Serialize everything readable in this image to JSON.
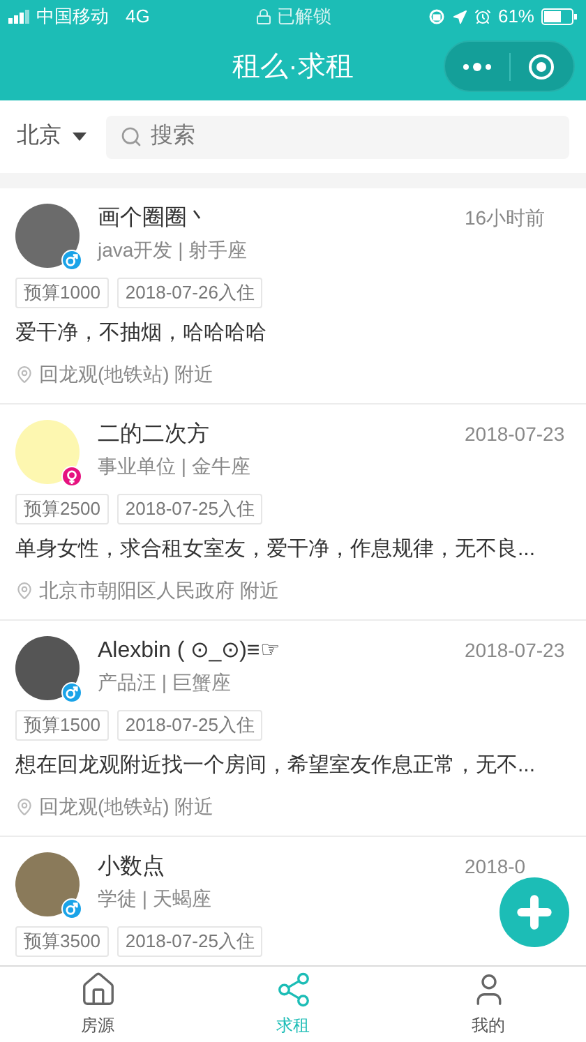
{
  "status_bar": {
    "carrier": "中国移动",
    "network": "4G",
    "lock_text": "已解锁",
    "battery": "61%"
  },
  "header": {
    "title": "租么·求租"
  },
  "search_bar": {
    "city": "北京",
    "placeholder": "搜索"
  },
  "posts": [
    {
      "name": "画个圈圈丶",
      "kind": "male",
      "avatar": {
        "color": "#6b6b6b"
      },
      "meta": "java开发 | 射手座",
      "time": "16小时前",
      "budget": "预算1000",
      "move_in": "2018-07-26入住",
      "description": "爱干净，不抽烟，哈哈哈哈",
      "location": "回龙观(地铁站) 附近"
    },
    {
      "name": "二的二次方",
      "kind": "female",
      "avatar": {
        "color": "#fdf7b0"
      },
      "meta": "事业单位 | 金牛座",
      "time": "2018-07-23",
      "budget": "预算2500",
      "move_in": "2018-07-25入住",
      "description": "单身女性，求合租女室友，爱干净，作息规律，无不良...",
      "location": "北京市朝阳区人民政府 附近"
    },
    {
      "name": "Alexbin ( ⊙_⊙)≡☞",
      "kind": "male",
      "avatar": {
        "color": "#555555"
      },
      "meta": "产品汪 | 巨蟹座",
      "time": "2018-07-23",
      "budget": "预算1500",
      "move_in": "2018-07-25入住",
      "description": "想在回龙观附近找一个房间，希望室友作息正常，无不...",
      "location": "回龙观(地铁站) 附近"
    },
    {
      "name": "小数点",
      "kind": "male",
      "avatar": {
        "color": "#8a7a5a"
      },
      "meta": "学徒 | 天蝎座",
      "time": "2018-0",
      "budget": "预算3500",
      "move_in": "2018-07-25入住"
    }
  ],
  "tab_bar": [
    {
      "label": "房源",
      "selected": false
    },
    {
      "label": "求租",
      "selected": true
    },
    {
      "label": "我的",
      "selected": false
    }
  ]
}
